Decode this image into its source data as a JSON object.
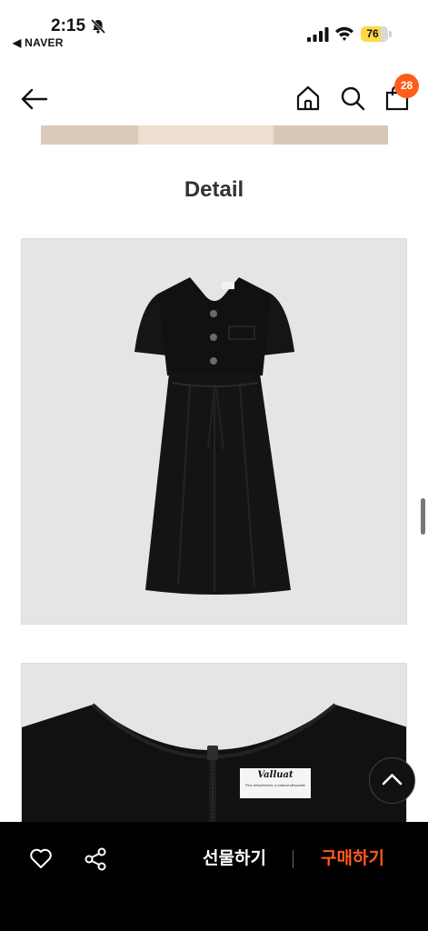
{
  "status_bar": {
    "time": "2:15",
    "back_app": "◀ NAVER",
    "battery": "76"
  },
  "header": {
    "cart_count": "28"
  },
  "section": {
    "title": "Detail"
  },
  "label": {
    "brand": "Valluat",
    "tagline": "Fine detachment, a natural silhouette"
  },
  "bottom_bar": {
    "gift_label": "선물하기",
    "buy_label": "구매하기"
  },
  "colors": {
    "accent": "#ff5a1f",
    "badge": "#ff5b1a",
    "image_bg": "#e5e5e6"
  }
}
